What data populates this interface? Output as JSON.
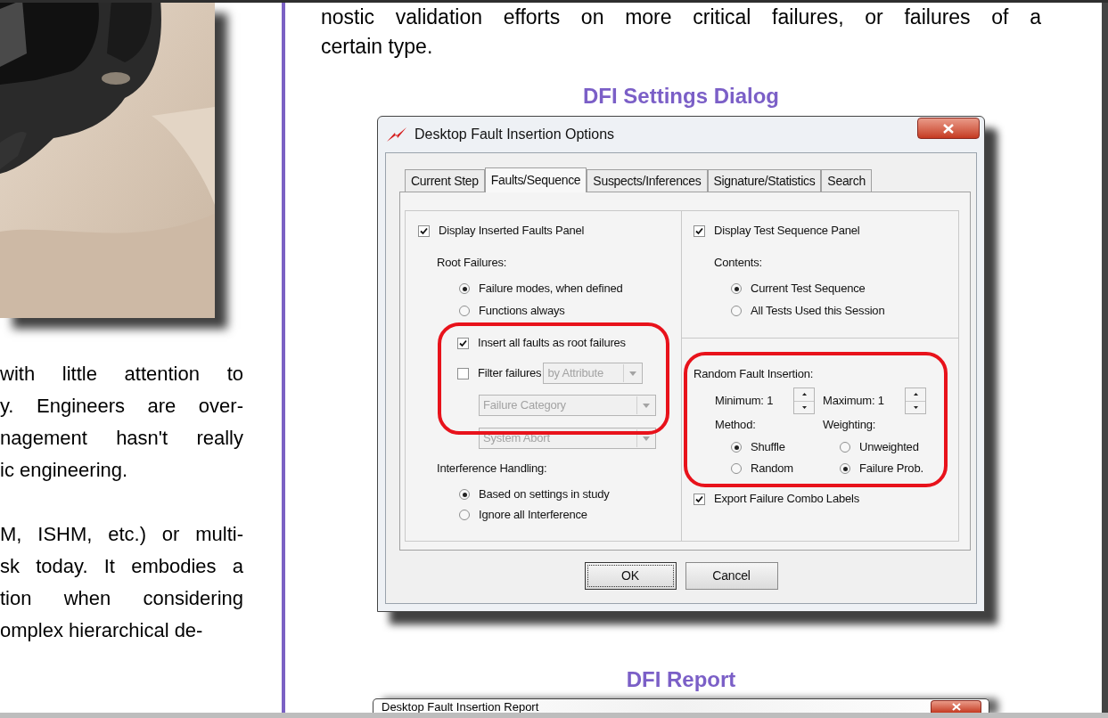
{
  "left_column": {
    "paragraphs": [
      [
        "with little attention to",
        "y. Engineers are over-",
        "nagement hasn't really",
        "ic engineering."
      ],
      [
        "M, ISHM, etc.) or multi-",
        "sk today. It embodies a",
        "tion when considering",
        "omplex hierarchical de-"
      ]
    ]
  },
  "right_column": {
    "lines": [
      "nostic validation efforts on more critical failures, or failures of a",
      "certain type."
    ]
  },
  "figure_1": {
    "caption": "DFI Settings Dialog",
    "dialog": {
      "title": "Desktop Fault Insertion Options",
      "tabs": [
        {
          "label": "Current Step",
          "selected": false
        },
        {
          "label": "Faults/Sequence",
          "selected": true
        },
        {
          "label": "Suspects/Inferences",
          "selected": false
        },
        {
          "label": "Signature/Statistics",
          "selected": false
        },
        {
          "label": "Search",
          "selected": false
        }
      ],
      "left_panel": {
        "display_checkbox": {
          "label": "Display Inserted Faults Panel",
          "checked": true
        },
        "root_failures_label": "Root Failures:",
        "root_options": [
          {
            "label": "Failure modes, when defined",
            "selected": true
          },
          {
            "label": "Functions always",
            "selected": false
          }
        ],
        "insert_all": {
          "label": "Insert all faults as root failures",
          "checked": true
        },
        "filter": {
          "label": "Filter failures",
          "checked": false,
          "dropdown": {
            "value": "by Attribute",
            "disabled": true
          }
        },
        "dropdowns": [
          {
            "value": "Failure Category",
            "disabled": true
          },
          {
            "value": "System Abort",
            "disabled": true
          }
        ],
        "interference_label": "Interference Handling:",
        "interference_options": [
          {
            "label": "Based on settings in study",
            "selected": true
          },
          {
            "label": "Ignore all Interference",
            "selected": false
          }
        ]
      },
      "right_panel": {
        "display_checkbox": {
          "label": "Display Test Sequence Panel",
          "checked": true
        },
        "contents_label": "Contents:",
        "contents_options": [
          {
            "label": "Current Test Sequence",
            "selected": true
          },
          {
            "label": "All Tests Used this Session",
            "selected": false
          }
        ],
        "random_title": "Random Fault Insertion:",
        "minimum": "Minimum: 1",
        "maximum": "Maximum: 1",
        "method_label": "Method:",
        "weighting_label": "Weighting:",
        "method_options": [
          {
            "label": "Shuffle",
            "selected": true
          },
          {
            "label": "Random",
            "selected": false
          }
        ],
        "weighting_options": [
          {
            "label": "Unweighted",
            "selected": false
          },
          {
            "label": "Failure Prob.",
            "selected": true
          }
        ],
        "export_checkbox": {
          "label": "Export Failure Combo Labels",
          "checked": true
        }
      },
      "buttons": [
        {
          "label": "OK",
          "default": true
        },
        {
          "label": "Cancel",
          "default": false
        }
      ]
    }
  },
  "figure_2": {
    "caption": "DFI Report",
    "window_title": "Desktop Fault Insertion Report"
  }
}
